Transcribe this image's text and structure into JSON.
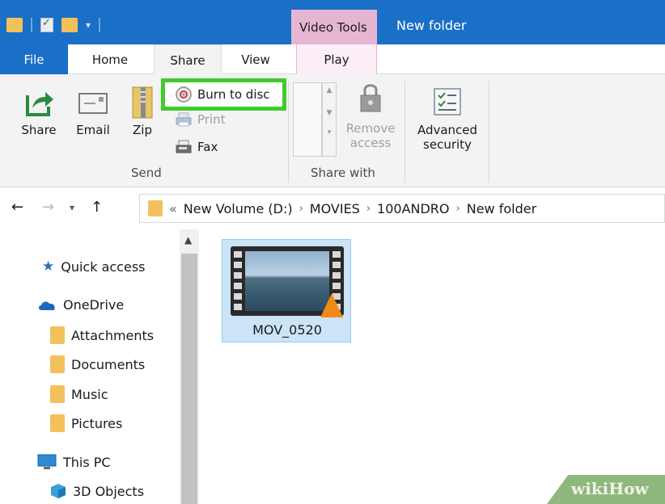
{
  "titlebar": {
    "context_tab": "Video Tools",
    "window_title": "New folder"
  },
  "tabs": {
    "file": "File",
    "home": "Home",
    "share": "Share",
    "view": "View",
    "play": "Play"
  },
  "ribbon": {
    "send": {
      "share": "Share",
      "email": "Email",
      "zip": "Zip",
      "burn_to_disc": "Burn to disc",
      "print": "Print",
      "fax": "Fax",
      "group_label": "Send"
    },
    "share_with": {
      "remove_access_line1": "Remove",
      "remove_access_line2": "access",
      "group_label": "Share with"
    },
    "advanced_security_line1": "Advanced",
    "advanced_security_line2": "security"
  },
  "address": {
    "overflow": "«",
    "crumbs": [
      "New Volume (D:)",
      "MOVIES",
      "100ANDRO",
      "New folder"
    ]
  },
  "navigation": {
    "quick_access": "Quick access",
    "onedrive": "OneDrive",
    "folders": [
      "Attachments",
      "Documents",
      "Music",
      "Pictures"
    ],
    "this_pc": "This PC",
    "objects_3d": "3D Objects"
  },
  "files": [
    {
      "name": "MOV_0520"
    }
  ],
  "watermark": "wikiHow",
  "colors": {
    "accent": "#1a6fc6",
    "context_tab": "#e6b5d2",
    "highlight": "#3fcc2a"
  }
}
